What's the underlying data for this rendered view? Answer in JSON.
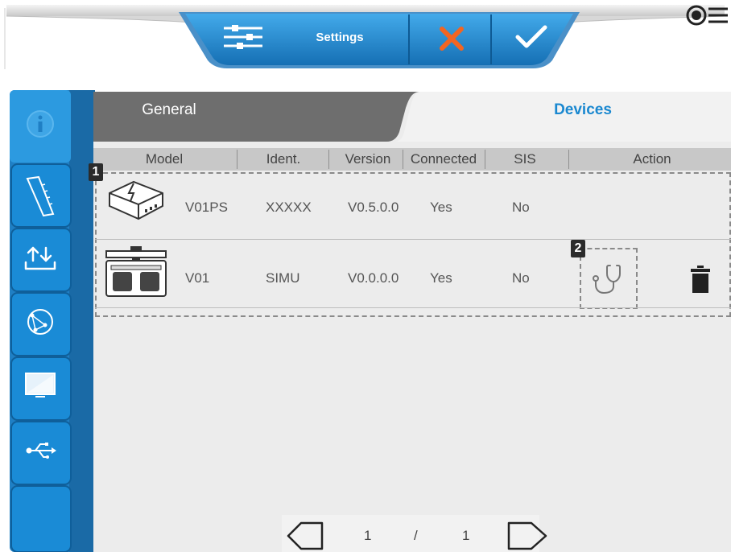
{
  "toolbar": {
    "settings_label": "Settings",
    "settings_icon": "sliders-icon",
    "cancel_icon": "close-icon",
    "confirm_icon": "checkmark-icon",
    "menu_icon": "menu-icon"
  },
  "sidebar": {
    "items": [
      {
        "icon": "info-icon"
      },
      {
        "icon": "ruler-icon"
      },
      {
        "icon": "upload-download-icon"
      },
      {
        "icon": "globe-network-icon"
      },
      {
        "icon": "monitor-icon"
      },
      {
        "icon": "usb-icon"
      },
      {
        "icon": "blank"
      }
    ]
  },
  "tabs": [
    {
      "label": "General",
      "active": false
    },
    {
      "label": "Devices",
      "active": true
    }
  ],
  "table": {
    "columns": [
      "Model",
      "Ident.",
      "Version",
      "Connected",
      "SIS",
      "Action"
    ],
    "rows": [
      {
        "device_icon": "power-supply-icon",
        "model": "V01PS",
        "ident": "XXXXX",
        "version": "V0.5.0.0",
        "connected": "Yes",
        "sis": "No",
        "actions": []
      },
      {
        "device_icon": "foot-switch-icon",
        "model": "V01",
        "ident": "SIMU",
        "version": "V0.0.0.0",
        "connected": "Yes",
        "sis": "No",
        "actions": [
          "stethoscope-icon",
          "trash-icon"
        ]
      }
    ]
  },
  "annotations": {
    "badge1": "1",
    "badge2": "2"
  },
  "pagination": {
    "current": "1",
    "separator": "/",
    "total": "1"
  },
  "colors": {
    "accent": "#1a88d0",
    "toolbar_blue": "#1f8fd6",
    "cancel": "#f26522"
  }
}
